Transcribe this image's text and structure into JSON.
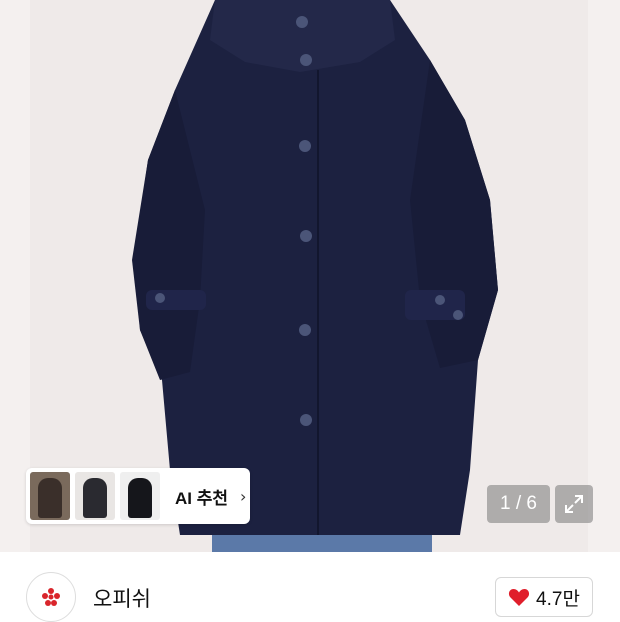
{
  "product_image": {
    "alt_subject": "navy-hooded-wool-coat"
  },
  "ai_recommend": {
    "label": "AI 추천",
    "chevron_icon": "chevron-right-icon"
  },
  "gallery": {
    "counter": "1 / 6",
    "expand_icon": "expand-icon"
  },
  "shop": {
    "name": "오피쉬",
    "logo_icon": "shop-logo-icon",
    "logo_color": "#d9252b"
  },
  "likes": {
    "count": "4.7만",
    "heart_icon": "heart-icon",
    "heart_color": "#e01e2b"
  }
}
